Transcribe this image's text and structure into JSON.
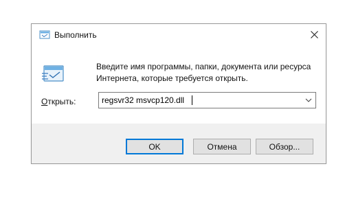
{
  "window": {
    "title": "Выполнить",
    "title_icon": "run-icon",
    "close_icon": "close-icon"
  },
  "content": {
    "description": "Введите имя программы, папки, документа или ресурса Интернета, которые требуется открыть.",
    "big_icon": "run-icon"
  },
  "open_field": {
    "label_accel": "О",
    "label_rest": "ткрыть:",
    "value": "regsvr32 msvcp120.dll",
    "dropdown_icon": "chevron-down-icon"
  },
  "buttons": {
    "ok": "OK",
    "cancel": "Отмена",
    "browse": "Обзор..."
  },
  "colors": {
    "accent": "#0078d7",
    "footer_bg": "#f0f0f0",
    "button_bg": "#e1e1e1"
  }
}
